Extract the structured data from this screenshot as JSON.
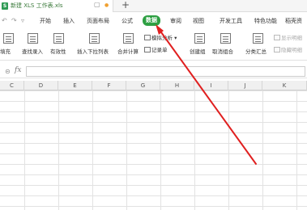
{
  "titlebar": {
    "doc_title": "新建 XLS 工作表.xls",
    "doc_icon_letter": "S",
    "restore_glyph": "▢",
    "dot_glyph": "●",
    "new_tab_glyph": "+"
  },
  "quick_access": {
    "undo": "↶",
    "redo": "↷",
    "more": "▿"
  },
  "menu": {
    "items": [
      "开始",
      "插入",
      "页面布局",
      "公式",
      "数据",
      "审阅",
      "视图",
      "开发工具",
      "特色功能",
      "稻壳资"
    ],
    "active_label": "数据",
    "active_color": "#2ea043"
  },
  "ribbon": {
    "labels": [
      "填充",
      "查找录入",
      "有效性",
      "插入下拉列表",
      "合并计算",
      "记录单",
      "创建组",
      "取消组合",
      "分类汇总"
    ],
    "simulated_analysis": "模拟分析",
    "show_detail": "显示明细",
    "hide_detail": "隐藏明细"
  },
  "formula_bar": {
    "magnify_glyph": "⊝",
    "fx_label": "fx",
    "value": ""
  },
  "columns": [
    "C",
    "D",
    "E",
    "F",
    "G",
    "H",
    "I",
    "J",
    "K"
  ],
  "annotation": {
    "arrow_color": "#e02020"
  }
}
